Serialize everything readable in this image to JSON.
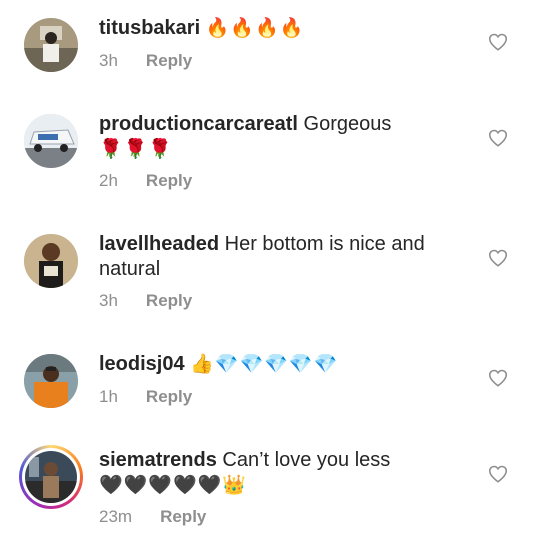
{
  "comments": [
    {
      "username": "titusbakari",
      "body": "",
      "emoji": "🔥🔥🔥🔥",
      "time": "3h",
      "reply": "Reply"
    },
    {
      "username": "productioncarcareatl",
      "body": "Gorgeous",
      "emoji": "🌹🌹🌹",
      "time": "2h",
      "reply": "Reply"
    },
    {
      "username": "lavellheaded",
      "body": "Her bottom is nice and natural",
      "emoji": "",
      "time": "3h",
      "reply": "Reply"
    },
    {
      "username": "leodisj04",
      "body": "",
      "emoji": "👍💎💎💎💎💎",
      "time": "1h",
      "reply": "Reply"
    },
    {
      "username": "siematrends",
      "body": "Can’t love you less",
      "emoji": "🖤🖤🖤🖤🖤👑",
      "time": "23m",
      "reply": "Reply"
    }
  ],
  "icons": {
    "like": "heart-outline-icon"
  },
  "colors": {
    "text": "#262626",
    "secondary": "#8e8e8e",
    "heart": "#8e8e8e"
  }
}
